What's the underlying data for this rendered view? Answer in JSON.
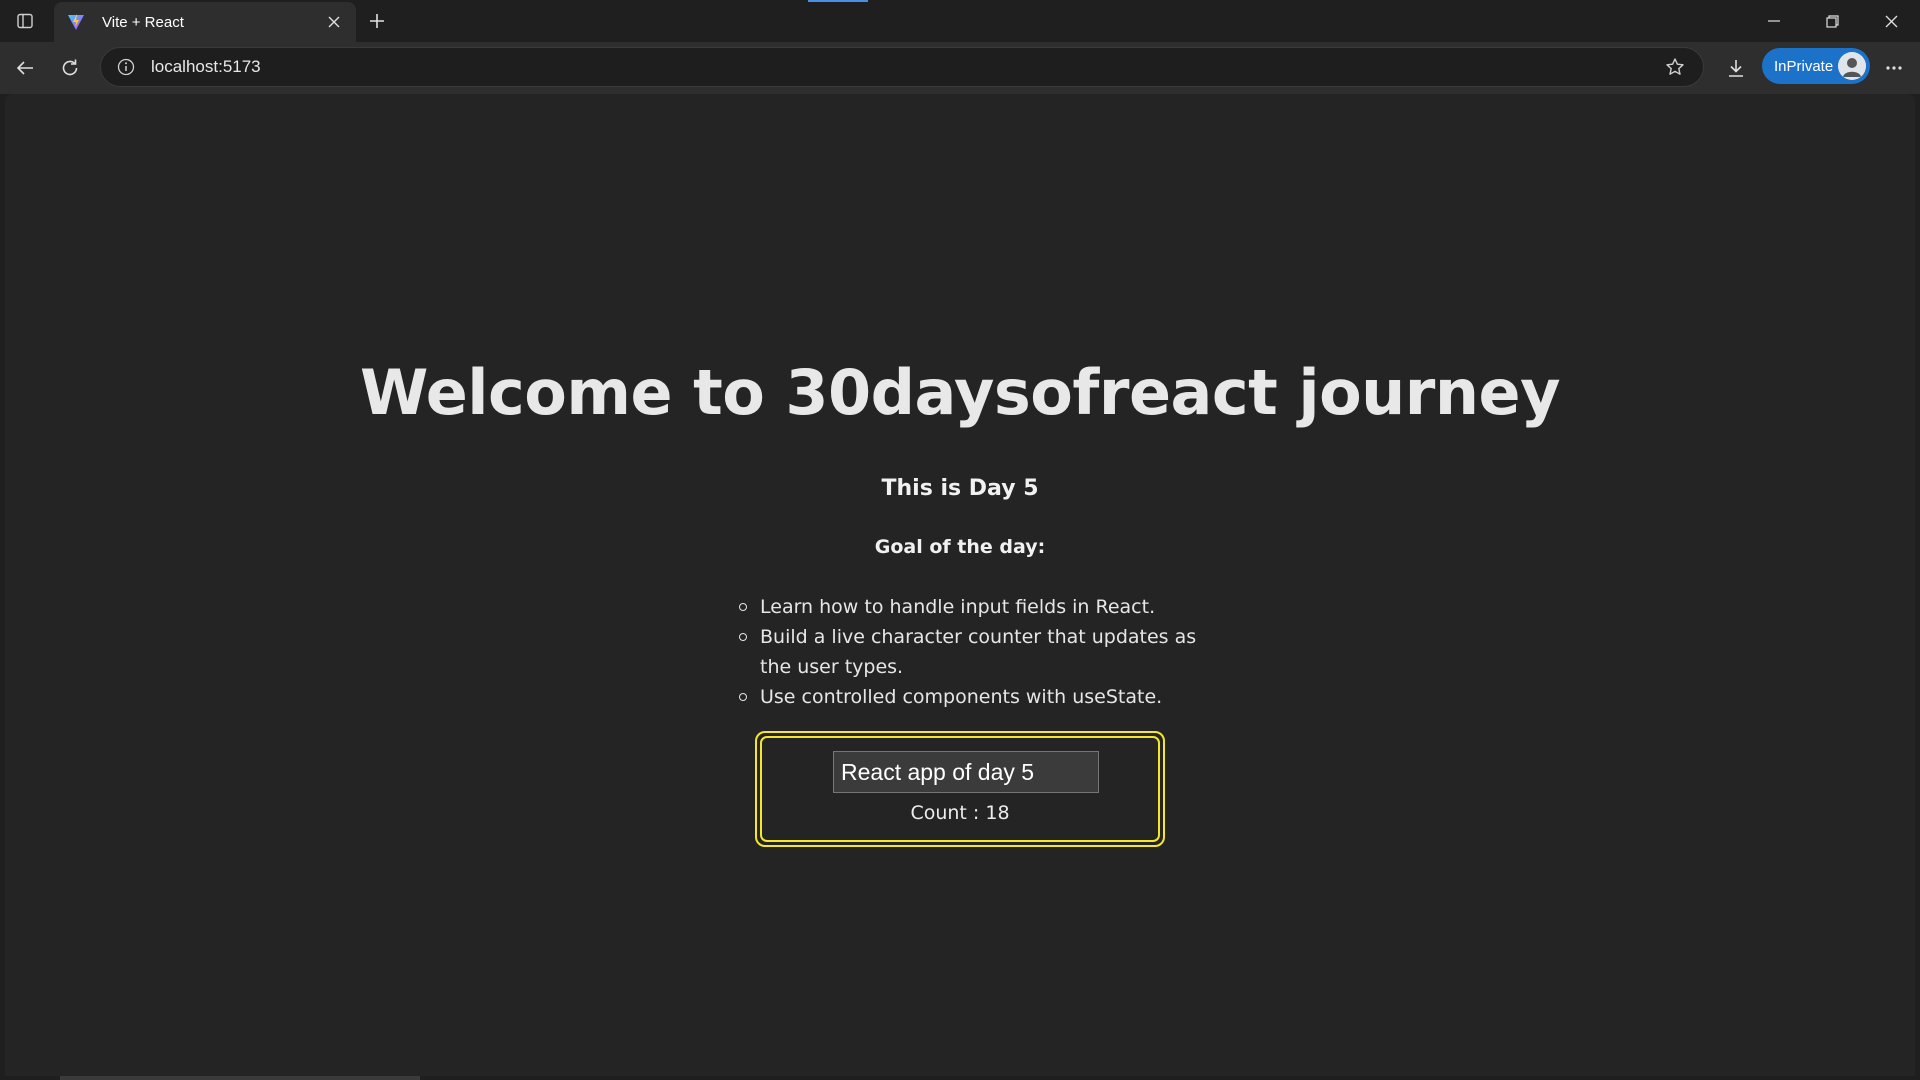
{
  "browser": {
    "tab": {
      "title": "Vite + React"
    },
    "address": {
      "url": "localhost:5173"
    },
    "profile": {
      "label": "InPrivate"
    },
    "colors": {
      "accent": "#1c72c9"
    }
  },
  "page": {
    "heading": "Welcome to 30daysofreact journey",
    "day": "This is Day 5",
    "goal_title": "Goal of the day:",
    "goals": [
      "Learn how to handle input fields in React.",
      "Build a live character counter that updates as the user types.",
      "Use controlled components with useState."
    ],
    "counter": {
      "input_value": "React app of day 5",
      "count_label": "Count : 18",
      "border_color": "#f5e629"
    }
  }
}
